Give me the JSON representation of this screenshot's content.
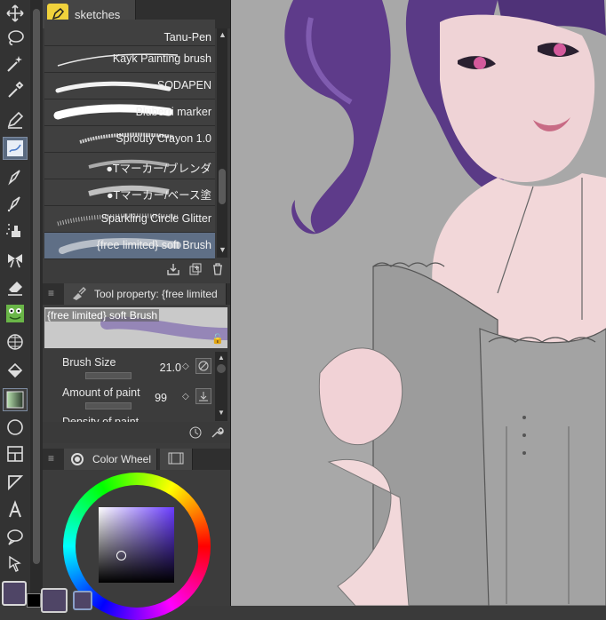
{
  "brush_panel": {
    "tab_label": "sketches",
    "brushes": [
      {
        "name": "Tanu-Pen",
        "selected": false
      },
      {
        "name": "Kayk Painting brush",
        "selected": false
      },
      {
        "name": "SODAPEN",
        "selected": false
      },
      {
        "name": "Bluberri marker",
        "selected": false
      },
      {
        "name": "Sprouty Crayon 1.0",
        "selected": false
      },
      {
        "name": "●Tマーカー/ブレンダ",
        "selected": false
      },
      {
        "name": "●Tマーカー/ベース塗",
        "selected": false
      },
      {
        "name": "Sparkling Circle Glitter",
        "selected": false
      },
      {
        "name": "{free limited} soft Brush",
        "selected": true
      }
    ]
  },
  "tool_property": {
    "header": "Tool property: {free limited",
    "brush_name": "{free limited} soft Brush",
    "brush_size_label": "Brush Size",
    "brush_size_value": "21.0",
    "amount_label": "Amount of paint",
    "amount_value": "99",
    "density_label": "Density of paint"
  },
  "color_panel": {
    "tab_label": "Color Wheel",
    "main_color": "#6a4fa8",
    "sub_color": "#1a1a1a",
    "current_color": "#4f4566"
  },
  "colors": {
    "accent_selection": "#5f6f86",
    "canvas_bg": "#a8a8a8"
  },
  "tools": [
    "move-icon",
    "lasso-icon",
    "magic-wand-icon",
    "eyedropper-icon",
    "pen-icon",
    "pencil-icon",
    "brush-icon",
    "airbrush-icon",
    "decoration-icon",
    "eraser-icon",
    "blend-icon",
    "figure-icon",
    "fill-icon",
    "gradient-icon",
    "ellipse-icon",
    "frame-icon",
    "ruler-icon",
    "text-icon",
    "balloon-icon",
    "operation-icon"
  ]
}
